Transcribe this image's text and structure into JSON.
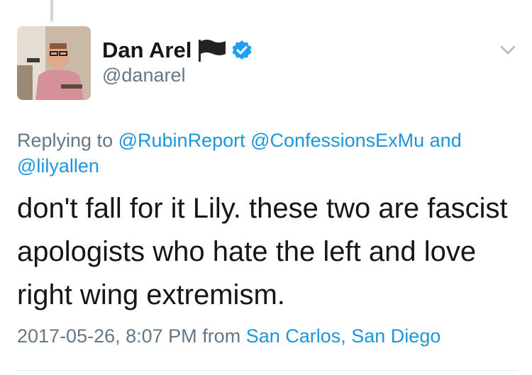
{
  "tweet": {
    "author": {
      "display_name": "Dan Arel",
      "handle": "@danarel",
      "flag_icon": "black-flag-icon",
      "verified_icon": "verified-badge-icon"
    },
    "reply": {
      "prefix": "Replying to",
      "mentions": [
        "@RubinReport",
        "@ConfessionsExMu"
      ],
      "joiner": "and",
      "last_mention": "@lilyallen"
    },
    "text": "don't fall for it Lily. these two are fascist apologists who hate the left and love right wing extremism.",
    "timestamp": "2017-05-26, 8:07 PM",
    "from_label": "from",
    "location": "San Carlos, San Diego"
  },
  "colors": {
    "link": "#1b95e0",
    "secondary_text": "#657786",
    "primary_text": "#14171a",
    "verified": "#1da1f2"
  }
}
